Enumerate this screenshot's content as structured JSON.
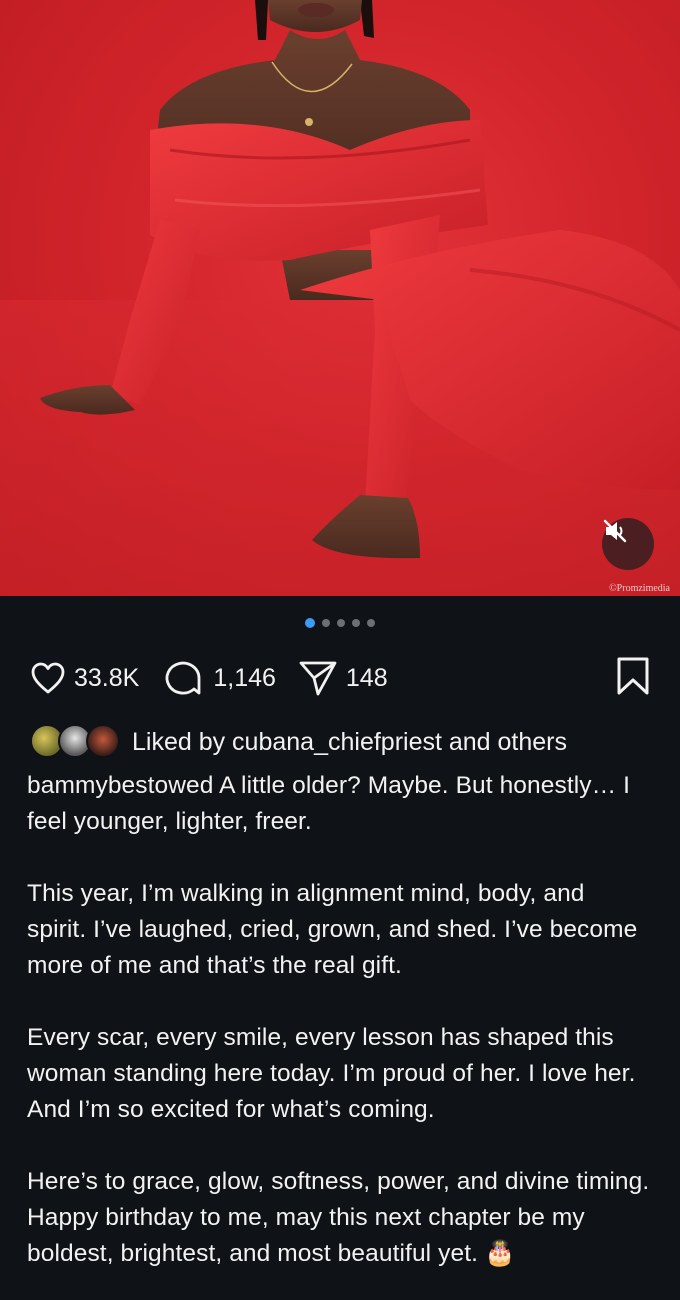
{
  "media": {
    "watermark": "©Promzimedia",
    "mute_icon": "volume-muted-icon",
    "carousel": {
      "count": 5,
      "active_index": 0
    }
  },
  "actions": {
    "likes": "33.8K",
    "comments": "1,146",
    "shares": "148"
  },
  "liked_by": {
    "text": "Liked by cubana_chiefpriest and others"
  },
  "caption": {
    "username": "bammybestowed",
    "paragraphs": [
      "A little older? Maybe. But honestly… I feel younger, lighter, freer.",
      "This year, I’m walking in alignment mind, body, and spirit. I’ve laughed, cried, grown, and shed. I’ve become more of me and that’s the real gift.",
      "Every scar, every smile, every lesson has shaped this woman standing here today. I’m proud of her. I love her. And I’m so excited for what’s coming.",
      "Here’s to grace, glow, softness, power, and divine timing.",
      "Happy birthday to me, may this next chapter be my boldest, brightest, and most beautiful yet. 🎂"
    ]
  },
  "colors": {
    "background": "#0f1216",
    "text": "#f2f2f2",
    "accent_dot": "#3d9bf5",
    "photo_red": "#d2242b"
  }
}
